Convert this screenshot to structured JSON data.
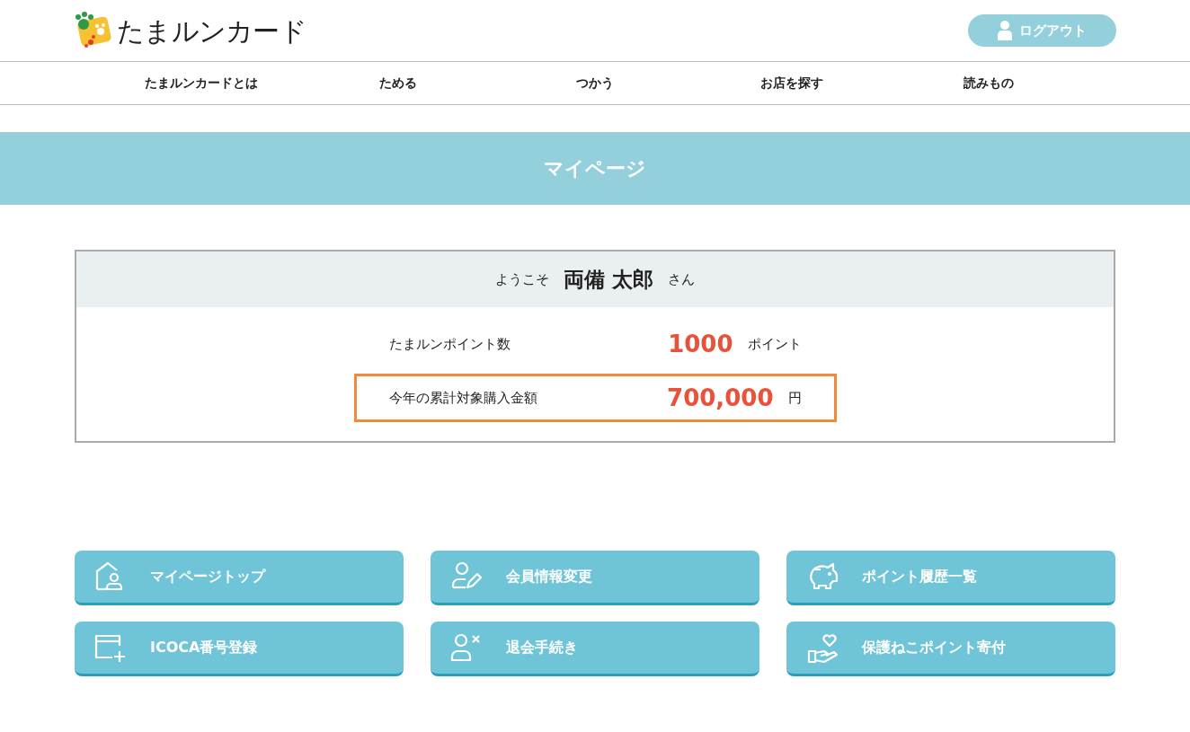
{
  "header": {
    "logo": "たまルンカード",
    "logout_button": "ログアウト"
  },
  "nav": [
    "たまルンカードとは",
    "ためる",
    "つかう",
    "お店を探す",
    "読みもの"
  ],
  "page_title": "マイページ",
  "welcome": {
    "prefix": "ようこそ",
    "name": "両備 太郎",
    "suffix": "さん"
  },
  "stats": [
    {
      "label": "たまルンポイント数",
      "value": "1000",
      "unit": "ポイント",
      "highlighted": false
    },
    {
      "label": "今年の累計対象購入金額",
      "value": "700,000",
      "unit": "円",
      "highlighted": true
    }
  ],
  "menu": [
    {
      "label": "マイページトップ"
    },
    {
      "label": "会員情報変更"
    },
    {
      "label": "ポイント履歴一覧"
    },
    {
      "label": "ICOCA番号登録"
    },
    {
      "label": "退会手続き"
    },
    {
      "label": "保護ねこポイント寄付"
    }
  ]
}
